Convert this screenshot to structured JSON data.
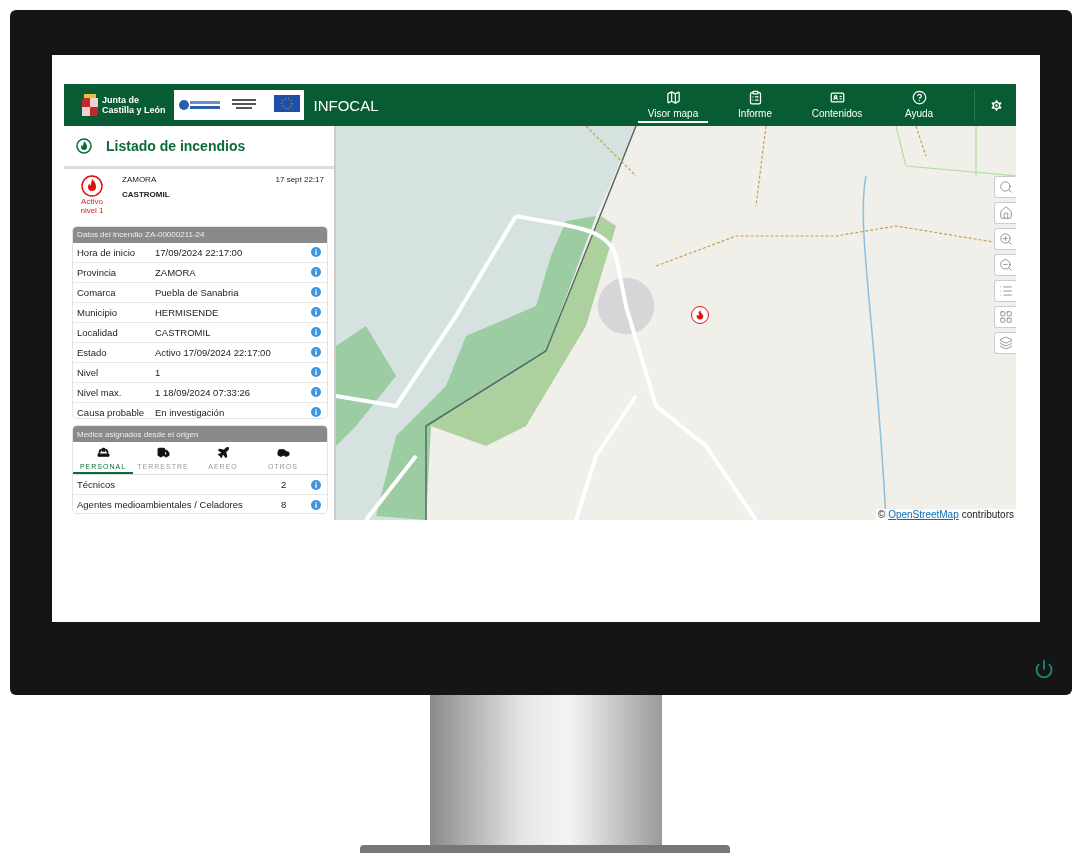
{
  "header": {
    "brand": [
      "Junta de",
      "Castilla y León"
    ],
    "app_title": "INFOCAL",
    "nav": [
      {
        "label": "Visor mapa",
        "selected": true
      },
      {
        "label": "Informe",
        "selected": false
      },
      {
        "label": "Contenidos",
        "selected": false
      },
      {
        "label": "Ayuda",
        "selected": false
      }
    ]
  },
  "sidebar": {
    "title": "Listado de incendios",
    "fire": {
      "status": "Activo",
      "level": "nivel 1",
      "province": "ZAMORA",
      "place": "CASTROMIL",
      "time": "17 sept 22:17"
    },
    "details": {
      "title": "Datos del incendio ZA-00000211-24",
      "rows": [
        {
          "label": "Hora de inicio",
          "value": "17/09/2024 22:17:00"
        },
        {
          "label": "Provincia",
          "value": "ZAMORA"
        },
        {
          "label": "Comarca",
          "value": "Puebla de Sanabria"
        },
        {
          "label": "Municipio",
          "value": "HERMISENDE"
        },
        {
          "label": "Localidad",
          "value": "CASTROMIL"
        },
        {
          "label": "Estado",
          "value": "Activo 17/09/2024 22:17:00"
        },
        {
          "label": "Nivel",
          "value": "1"
        },
        {
          "label": "Nivel max.",
          "value": "1 18/09/2024 07:33:26"
        },
        {
          "label": "Causa probable",
          "value": "En investigación"
        }
      ]
    },
    "resources": {
      "title": "Medios asignados desde el origen",
      "tabs": [
        {
          "label": "PERSONAL",
          "selected": true
        },
        {
          "label": "TERRESTRE",
          "selected": false
        },
        {
          "label": "AEREO",
          "selected": false
        },
        {
          "label": "OTROS",
          "selected": false
        }
      ],
      "rows": [
        {
          "label": "Técnicos",
          "count": "2"
        },
        {
          "label": "Agentes medioambientales / Celadores",
          "count": "8"
        }
      ]
    }
  },
  "map": {
    "attribution_symbol": "©",
    "attribution_link": "OpenStreetMap",
    "attribution_rest": "contributors"
  }
}
